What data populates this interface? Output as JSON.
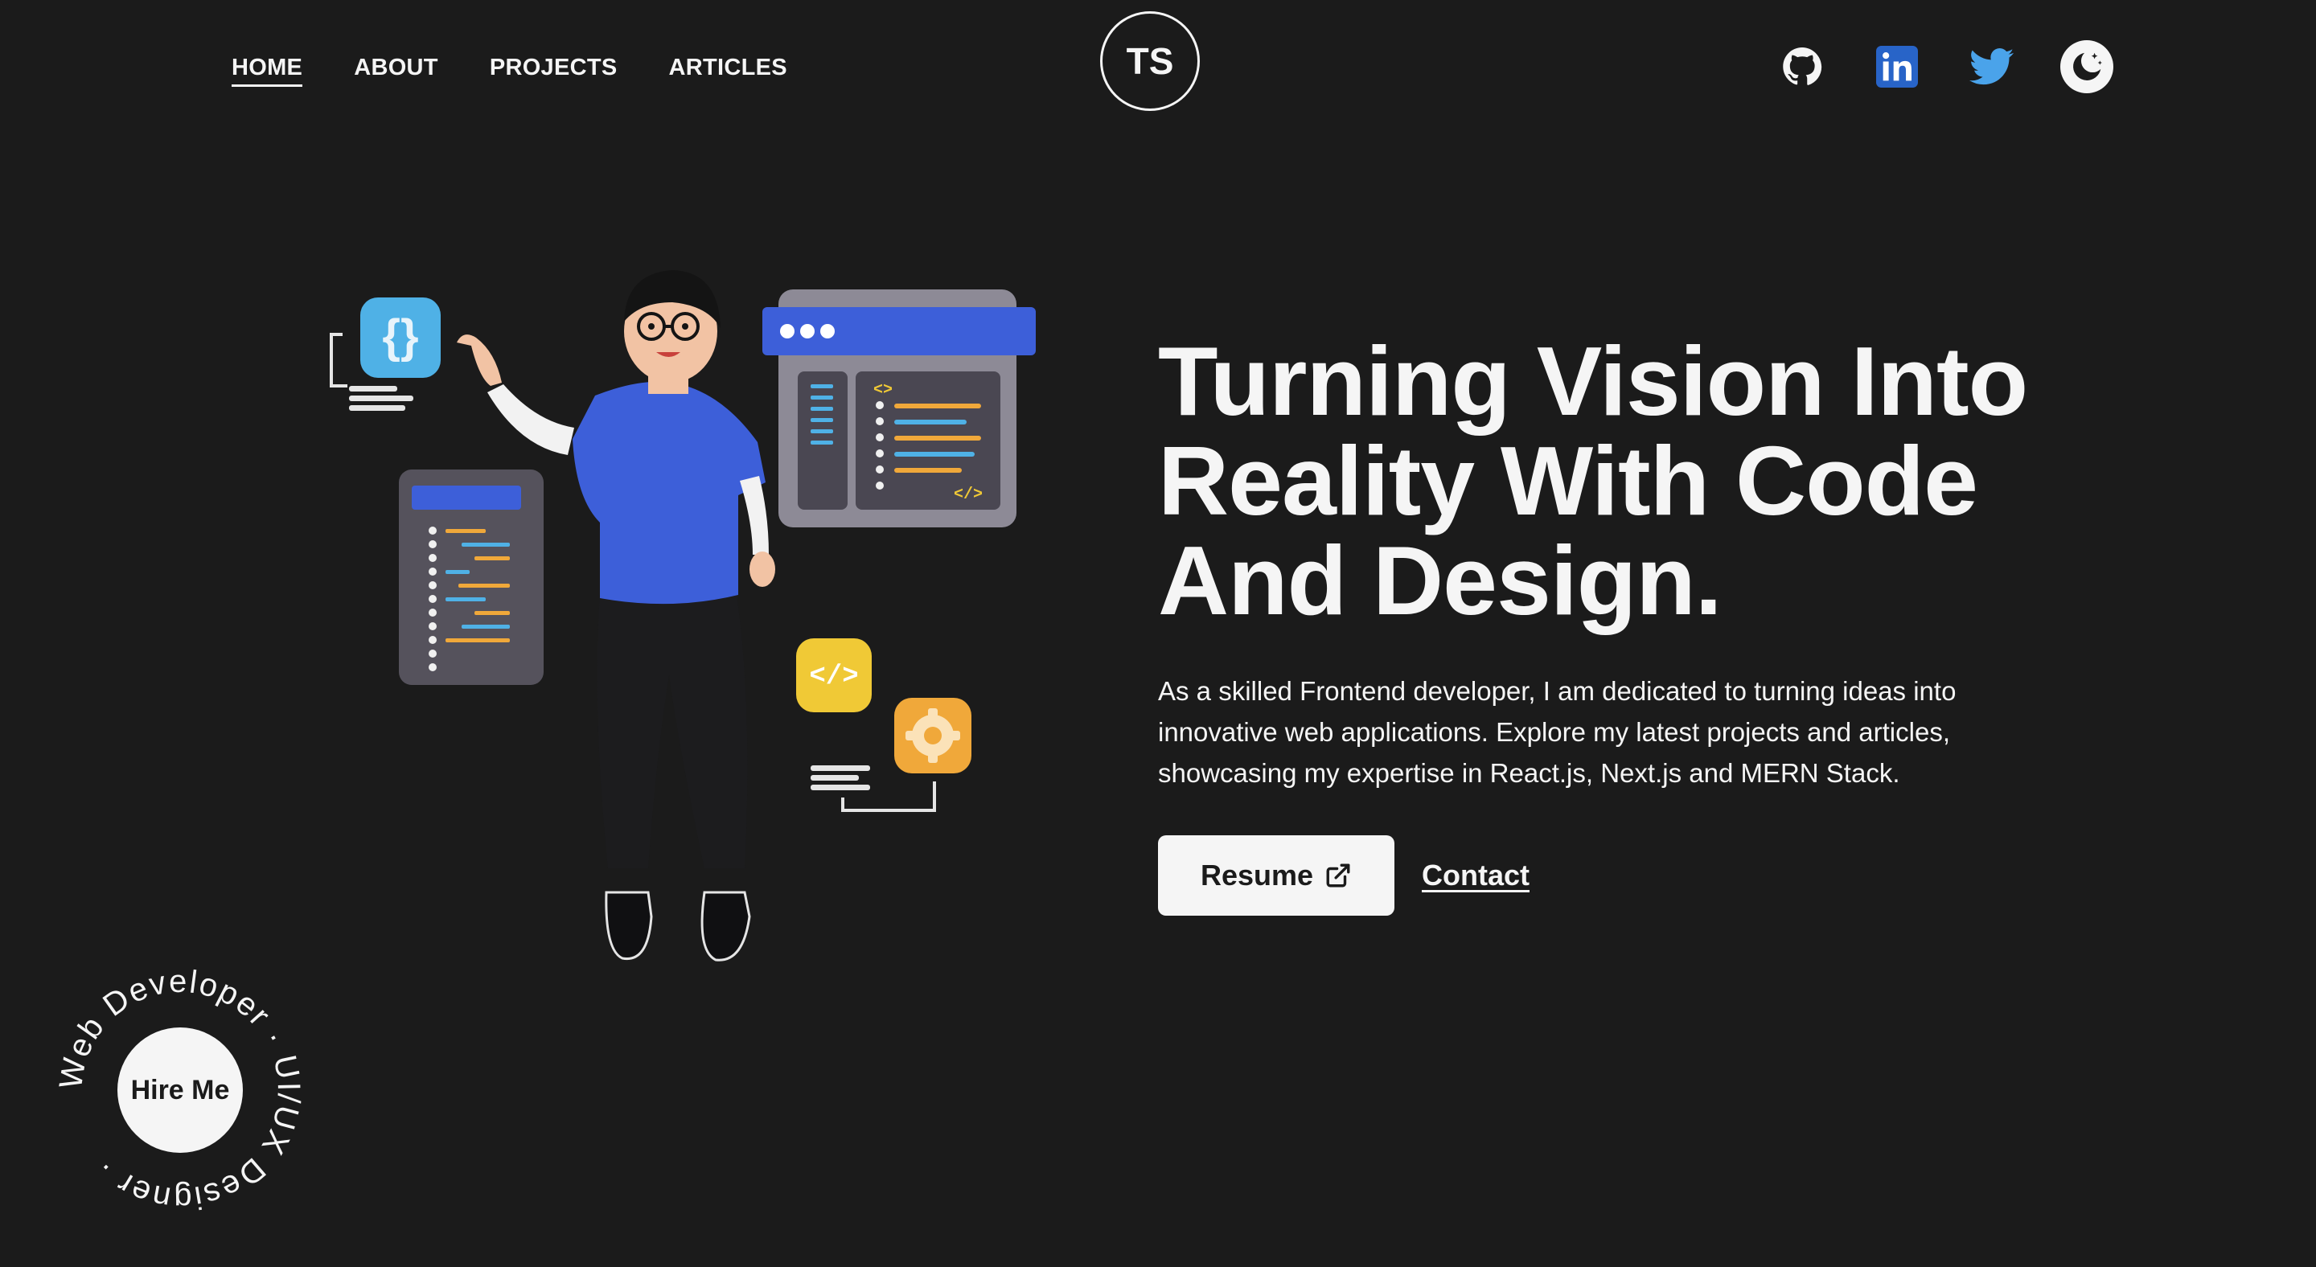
{
  "nav": {
    "links": [
      {
        "label": "HOME",
        "active": true
      },
      {
        "label": "ABOUT",
        "active": false
      },
      {
        "label": "PROJECTS",
        "active": false
      },
      {
        "label": "ARTICLES",
        "active": false
      }
    ],
    "logo": "TS",
    "socials": [
      {
        "icon": "github-icon",
        "color": "#f5f5f5"
      },
      {
        "icon": "linkedin-icon",
        "color": "#2864c8"
      },
      {
        "icon": "twitter-icon",
        "color": "#4aa3ea"
      },
      {
        "icon": "moon-icon",
        "color": "#f5f5f5"
      }
    ]
  },
  "hero": {
    "headline_lines": [
      "Turning Vision Into",
      "Reality With Code",
      "And Design."
    ],
    "description": "As a skilled Frontend developer, I am dedicated to turning ideas into innovative web applications. Explore my latest projects and articles, showcasing my expertise in React.js, Next.js and MERN Stack.",
    "resume_label": "Resume",
    "contact_label": "Contact"
  },
  "hire": {
    "label": "Hire Me",
    "ring_text": "Web Developer · UI/UX Designer ·"
  },
  "colors": {
    "background": "#1b1b1b",
    "foreground": "#f5f5f5",
    "accent_blue": "#3d5fd9",
    "accent_yellow": "#f0c936",
    "accent_orange": "#f0a83a"
  }
}
